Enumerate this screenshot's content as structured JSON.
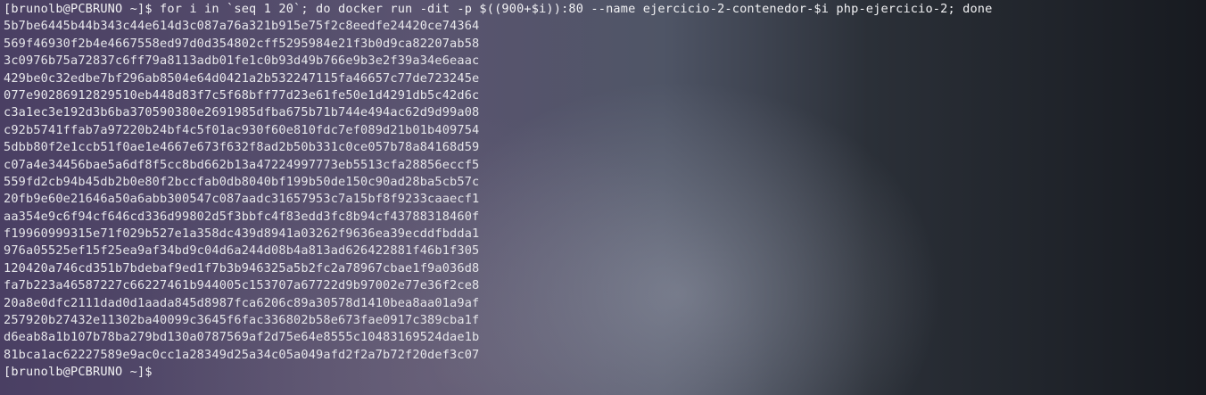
{
  "terminal": {
    "command_prompt": "[brunolb@PCBRUNO ~]$ ",
    "command": "for i in `seq 1 20`; do docker run -dit -p $((900+$i)):80 --name ejercicio-2-contenedor-$i php-ejercicio-2; done",
    "output_lines": [
      "5b7be6445b44b343c44e614d3c087a76a321b915e75f2c8eedfe24420ce74364",
      "569f46930f2b4e4667558ed97d0d354802cff5295984e21f3b0d9ca82207ab58",
      "3c0976b75a72837c6ff79a8113adb01fe1c0b93d49b766e9b3e2f39a34e6eaac",
      "429be0c32edbe7bf296ab8504e64d0421a2b532247115fa46657c77de723245e",
      "077e90286912829510eb448d83f7c5f68bff77d23e61fe50e1d4291db5c42d6c",
      "c3a1ec3e192d3b6ba370590380e2691985dfba675b71b744e494ac62d9d99a08",
      "c92b5741ffab7a97220b24bf4c5f01ac930f60e810fdc7ef089d21b01b409754",
      "5dbb80f2e1ccb51f0ae1e4667e673f632f8ad2b50b331c0ce057b78a84168d59",
      "c07a4e34456bae5a6df8f5cc8bd662b13a47224997773eb5513cfa28856eccf5",
      "559fd2cb94b45db2b0e80f2bccfab0db8040bf199b50de150c90ad28ba5cb57c",
      "20fb9e60e21646a50a6abb300547c087aadc31657953c7a15bf8f9233caaecf1",
      "aa354e9c6f94cf646cd336d99802d5f3bbfc4f83edd3fc8b94cf43788318460f",
      "f19960999315e71f029b527e1a358dc439d8941a03262f9636ea39ecddfbdda1",
      "976a05525ef15f25ea9af34bd9c04d6a244d08b4a813ad626422881f46b1f305",
      "120420a746cd351b7bdebaf9ed1f7b3b946325a5b2fc2a78967cbae1f9a036d8",
      "fa7b223a46587227c66227461b944005c153707a67722d9b97002e77e36f2ce8",
      "20a8e0dfc2111dad0d1aada845d8987fca6206c89a30578d1410bea8aa01a9af",
      "257920b27432e11302ba40099c3645f6fac336802b58e673fae0917c389cba1f",
      "d6eab8a1b107b78ba279bd130a0787569af2d75e64e8555c10483169524dae1b",
      "81bca1ac62227589e9ac0cc1a28349d25a34c05a049afd2f2a7b72f20def3c07"
    ],
    "final_prompt": "[brunolb@PCBRUNO ~]$"
  }
}
